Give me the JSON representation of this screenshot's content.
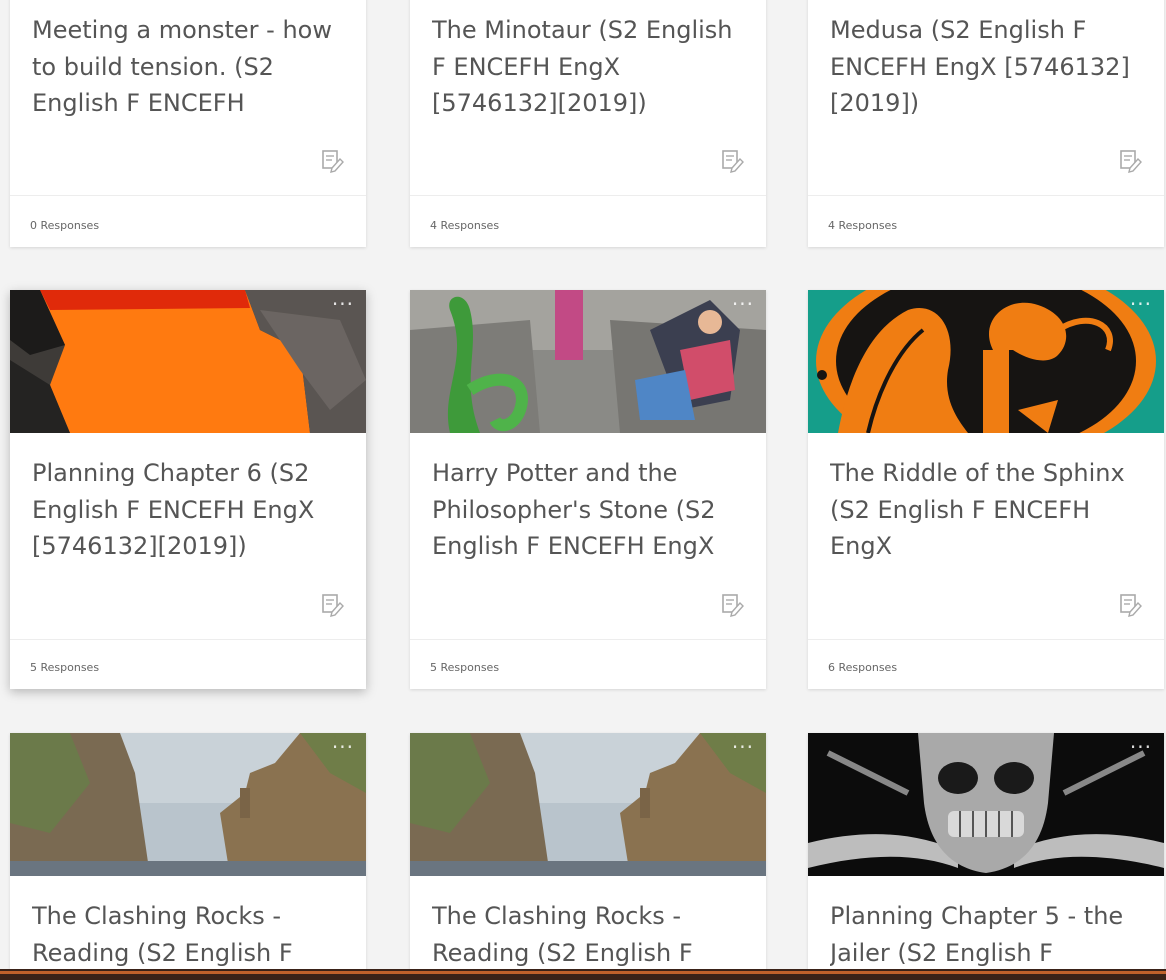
{
  "cards": [
    {
      "title": "Meeting a monster - how to build tension. (S2 English F ENCEFH",
      "responses": "0 Responses",
      "image": "none"
    },
    {
      "title": "The Minotaur (S2 English F ENCEFH EngX [5746132][2019])",
      "responses": "4 Responses",
      "image": "none"
    },
    {
      "title": "Medusa (S2 English F ENCEFH EngX [5746132][2019])",
      "responses": "4 Responses",
      "image": "none"
    },
    {
      "title": "Planning Chapter 6 (S2 English F ENCEFH EngX [5746132][2019])",
      "responses": "5 Responses",
      "image": "lava",
      "menu": "···"
    },
    {
      "title": "Harry Potter and the Philosopher's Stone (S2 English F ENCEFH EngX",
      "responses": "5 Responses",
      "image": "maze",
      "menu": "···"
    },
    {
      "title": "The Riddle of the Sphinx (S2 English F ENCEFH EngX",
      "responses": "6 Responses",
      "image": "greek-vase",
      "menu": "···"
    },
    {
      "title": "The Clashing Rocks - Reading  (S2 English F",
      "image": "rocks",
      "menu": "···"
    },
    {
      "title": "The Clashing Rocks - Reading  (S2 English F",
      "image": "rocks",
      "menu": "···"
    },
    {
      "title": "Planning Chapter 5 - the Jailer (S2 English F",
      "image": "skull",
      "menu": "···"
    }
  ],
  "colors": {
    "accent_bar": "#c0612b",
    "lava": "#ff7a10",
    "sphinx_orange": "#f07d12",
    "sphinx_teal": "#159e8a"
  },
  "icons": {
    "note": "note-edit-icon"
  }
}
